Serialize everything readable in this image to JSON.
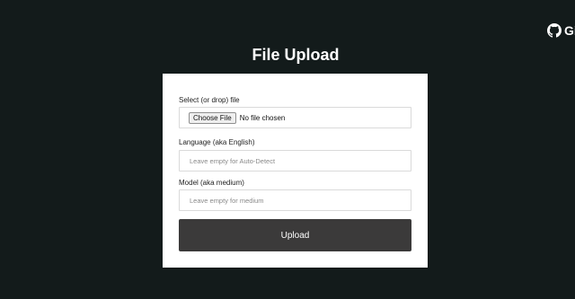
{
  "github": {
    "label": "GitHub",
    "icon": "github-icon"
  },
  "title": "File Upload",
  "form": {
    "file_field": {
      "label": "Select (or drop) file",
      "button_label": "Choose File",
      "status": "No file chosen"
    },
    "language_field": {
      "label": "Language (aka English)",
      "placeholder": "Leave empty for Auto-Detect",
      "value": ""
    },
    "model_field": {
      "label": "Model (aka medium)",
      "placeholder": "Leave empty for medium",
      "value": ""
    },
    "upload_label": "Upload"
  },
  "colors": {
    "background": "#131b1b",
    "card": "#ffffff",
    "button": "#3b3a3a"
  }
}
